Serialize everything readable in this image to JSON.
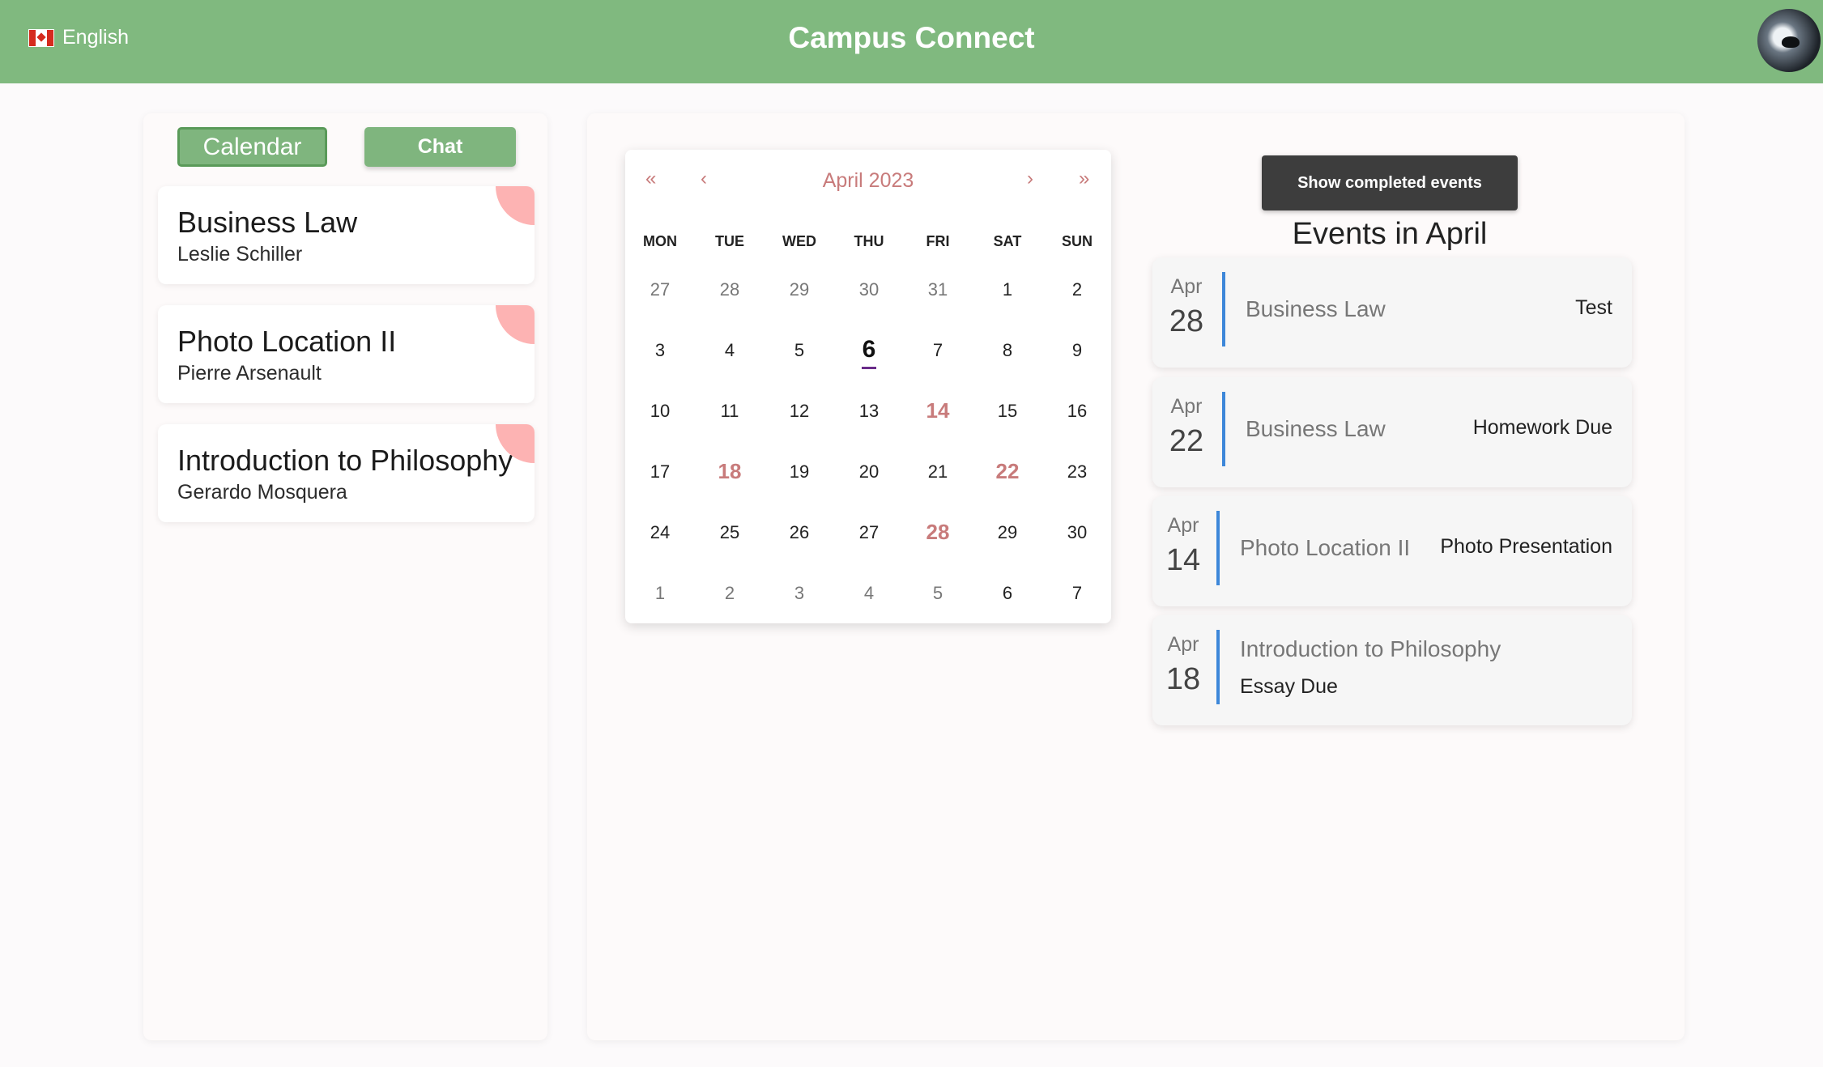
{
  "header": {
    "language": "English",
    "title": "Campus Connect"
  },
  "sidebar": {
    "tabs": {
      "calendar": "Calendar",
      "chat": "Chat"
    },
    "courses": [
      {
        "name": "Business Law",
        "professor": "Leslie Schiller"
      },
      {
        "name": "Photo Location II",
        "professor": "Pierre Arsenault"
      },
      {
        "name": "Introduction to Philosophy",
        "professor": "Gerardo Mosquera"
      }
    ]
  },
  "calendar": {
    "month_label": "April 2023",
    "nav": {
      "prev_year": "«",
      "prev_month": "‹",
      "next_month": "›",
      "next_year": "»"
    },
    "weekdays": [
      "MON",
      "TUE",
      "WED",
      "THU",
      "FRI",
      "SAT",
      "SUN"
    ],
    "weeks": [
      [
        "27",
        "28",
        "29",
        "30",
        "31",
        "1",
        "2"
      ],
      [
        "3",
        "4",
        "5",
        "6",
        "7",
        "8",
        "9"
      ],
      [
        "10",
        "11",
        "12",
        "13",
        "14",
        "15",
        "16"
      ],
      [
        "17",
        "18",
        "19",
        "20",
        "21",
        "22",
        "23"
      ],
      [
        "24",
        "25",
        "26",
        "27",
        "28",
        "29",
        "30"
      ],
      [
        "1",
        "2",
        "3",
        "4",
        "5",
        "6",
        "7"
      ]
    ]
  },
  "events_panel": {
    "show_completed_label": "Show completed events",
    "heading": "Events in April",
    "events": [
      {
        "month": "Apr",
        "day": "28",
        "course": "Business Law",
        "type": "Test"
      },
      {
        "month": "Apr",
        "day": "22",
        "course": "Business Law",
        "type": "Homework Due"
      },
      {
        "month": "Apr",
        "day": "14",
        "course": "Photo Location II",
        "type": "Photo Presentation"
      },
      {
        "month": "Apr",
        "day": "18",
        "course": "Introduction to Philosophy",
        "type": "Essay Due"
      }
    ]
  },
  "colors": {
    "header_green": "#80b97f",
    "event_highlight": "#c87b7b",
    "event_bar": "#3d87d9",
    "course_corner": "#fdb3b3"
  }
}
